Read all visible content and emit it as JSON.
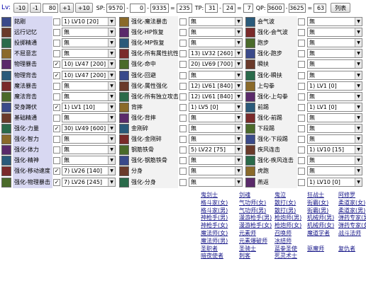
{
  "topbar": {
    "lv_label": "Lv:",
    "buttons": [
      "-10",
      "-1"
    ],
    "lv_value": "80",
    "buttons2": [
      "+1",
      "+10"
    ],
    "sp_label": "SP:",
    "sp_a": "9570",
    "sp_op1": "-",
    "sp_b": "0",
    "sp_op2": "-",
    "sp_c": "9335",
    "sp_op3": "=",
    "sp_result": "235",
    "tp_label": "TP:",
    "tp_a": "31",
    "tp_op1": "-",
    "tp_b": "24",
    "tp_op2": "=",
    "tp_result": "7",
    "qp_label": "QP:",
    "qp_a": "3600",
    "qp_op1": "-",
    "qp_b": "3625",
    "qp_op2": "=",
    "qp_result": "63",
    "list_button": "列表"
  },
  "rows": [
    {
      "name": "銘剛",
      "checked": false,
      "sel1": "1) LV10 [20]",
      "name2": "强化-魔法暴击",
      "sel2": "無",
      "name3": "会气波",
      "sel3": "無"
    },
    {
      "name": "远行记忆",
      "checked": false,
      "sel1": "無",
      "name2": "强化-HP恢复",
      "sel2": "無",
      "name3": "强化-会气波",
      "sel3": "無"
    },
    {
      "name": "投掷精通",
      "checked": false,
      "sel1": "無",
      "name2": "强化-MP恢复",
      "sel2": "無",
      "name3": "跑步",
      "sel3": "無"
    },
    {
      "name": "不屈意志",
      "checked": false,
      "sel1": "無",
      "name2": "强化-所有属性抗性",
      "sel2": "13) LV32 [260]",
      "name3": "强化-跑步",
      "sel3": "無"
    },
    {
      "name": "物理暴击",
      "checked": true,
      "sel1": "10) LV47 [200]",
      "name2": "强化-命中",
      "sel2": "20) LV69 [700]",
      "name3": "瞬扶",
      "sel3": "無"
    },
    {
      "name": "物理背击",
      "checked": true,
      "sel1": "10) LV47 [200]",
      "name2": "强化-回避",
      "sel2": "無",
      "name3": "强化-瞬扶",
      "sel3": "無"
    },
    {
      "name": "魔法暴击",
      "checked": false,
      "sel1": "無",
      "name2": "强化-属性强化",
      "sel2": "12) LV61 [840]",
      "name3": "上勾拳",
      "sel3": "1) LV1 [0]"
    },
    {
      "name": "魔法背击",
      "checked": false,
      "sel1": "無",
      "name2": "强化-所有独立攻击",
      "sel2": "12) LV61 [840]",
      "name3": "强化-上勾拳",
      "sel3": "無"
    },
    {
      "name": "受身蹲伏",
      "checked": true,
      "sel1": "1) LV1 [10]",
      "name2": "背摔",
      "sel2": "1) LV5 [0]",
      "name3": "前踢",
      "sel3": "1) LV1 [0]"
    },
    {
      "name": "基础精通",
      "checked": false,
      "sel1": "無",
      "name2": "强化-背摔",
      "sel2": "無",
      "name3": "强化-前踢",
      "sel3": "無"
    },
    {
      "name": "强化-力量",
      "checked": true,
      "sel1": "30) LV49 [600]",
      "name2": "金刚碎",
      "sel2": "無",
      "name3": "下段踢",
      "sel3": "無"
    },
    {
      "name": "强化-智力",
      "checked": false,
      "sel1": "無",
      "name2": "强化-金刚碎",
      "sel2": "無",
      "name3": "强化-下段踢",
      "sel3": "無"
    },
    {
      "name": "强化-体力",
      "checked": false,
      "sel1": "無",
      "name2": "钢筋铁骨",
      "sel2": "5) LV22 [75]",
      "name3": "疾风连击",
      "sel3": "1) LV10 [15]"
    },
    {
      "name": "强化-精神",
      "checked": false,
      "sel1": "無",
      "name2": "强化-钢筋铁骨",
      "sel2": "無",
      "name3": "强化-疾风连击",
      "sel3": "無"
    },
    {
      "name": "强化-移动速度",
      "checked": true,
      "sel1": "7) LV26 [140]",
      "name2": "分身",
      "sel2": "無",
      "name3": "虎跑",
      "sel3": "無"
    },
    {
      "name": "强化-物理暴击",
      "checked": true,
      "sel1": "7) LV26 [245]",
      "name2": "强化-分身",
      "sel2": "無",
      "name3": "燕返",
      "sel3": "1) LV10 [0]"
    }
  ],
  "links": [
    [
      "鬼剑士",
      "剑魂",
      "鬼泣",
      "狂战士",
      "阿修罗"
    ],
    [
      "格斗家(女)",
      "气功师(女)",
      "散打(女)",
      "街霸(女)",
      "柔道家(女)"
    ],
    [
      "格斗家(男)",
      "气功师(男)",
      "散打(男)",
      "街霸(男)",
      "柔道家(男)"
    ],
    [
      "神枪手(男)",
      "漫游枪手(男)",
      "枪炮师(男)",
      "机械师(男)",
      "弹药专家(男)"
    ],
    [
      "神枪手(女)",
      "漫游枪手(女)",
      "枪炮师(女)",
      "机械师(女)",
      "弹药专家(女)"
    ],
    [
      "魔法师(女)",
      "元素师",
      "召唤师",
      "魔道学者",
      "战斗法师"
    ],
    [
      "魔法师(男)",
      "元素爆破师",
      "冰结师"
    ],
    [
      "圣职者",
      "圣骑士",
      "蓝拳圣使",
      "驱魔师",
      "复仇者"
    ],
    [
      "暗夜使者",
      "刺客",
      "死灵术士"
    ]
  ],
  "colors": {
    "icon_palette": [
      "#3a4a8a",
      "#6a3a2a",
      "#2a6a4a",
      "#8a6a2a",
      "#5a2a6a",
      "#2a5a7a",
      "#7a2a2a",
      "#4a6a2a"
    ]
  }
}
